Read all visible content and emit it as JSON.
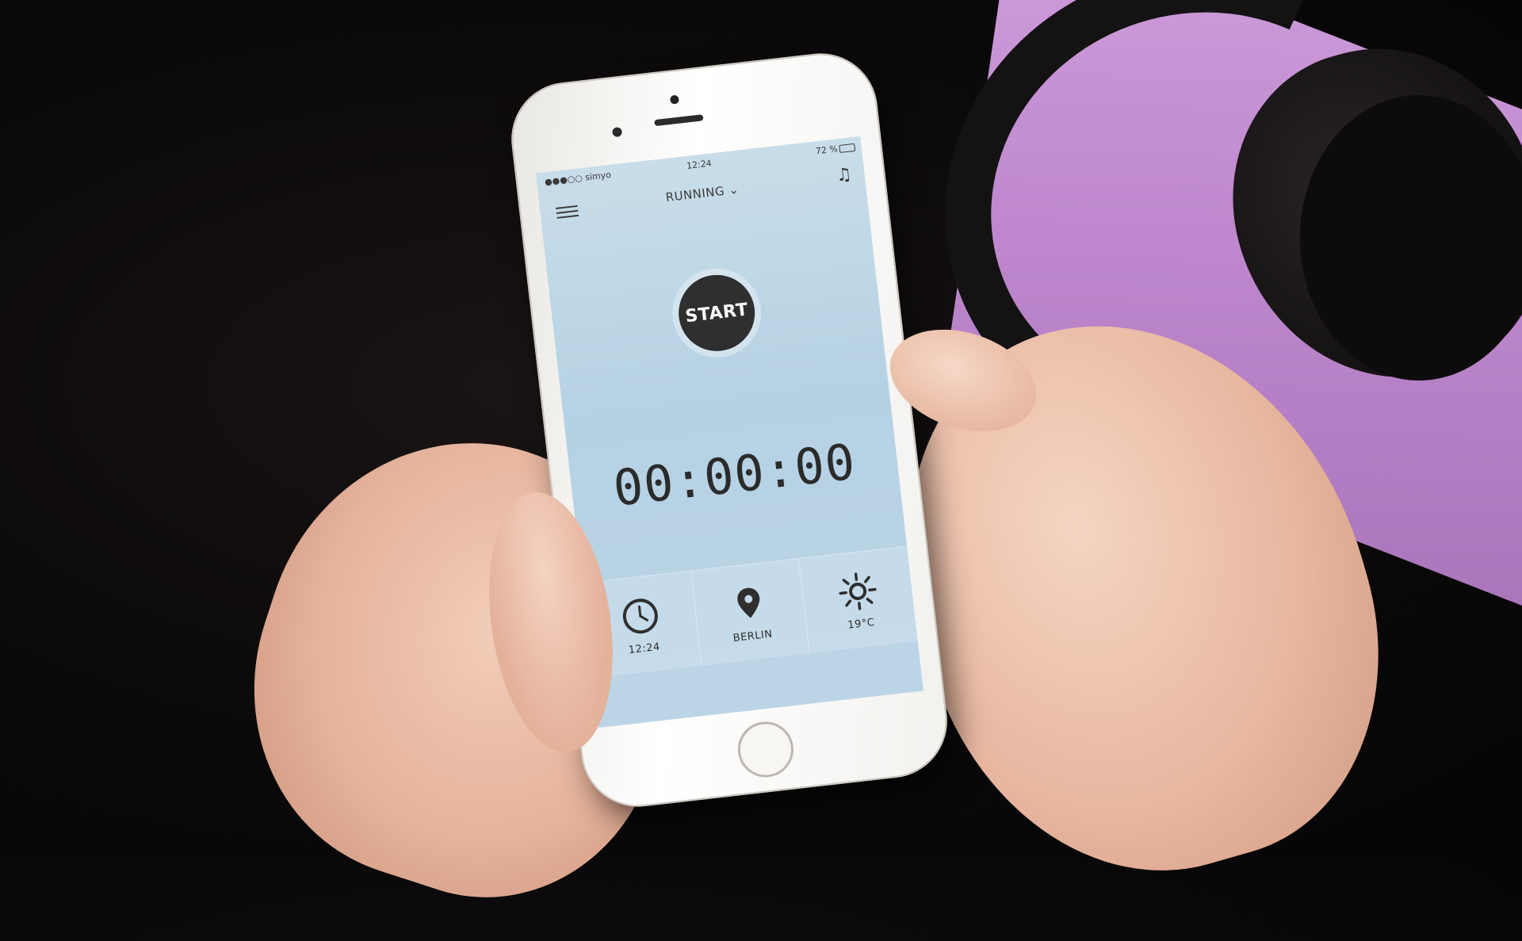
{
  "status_bar": {
    "carrier": "●●●○○ simyo",
    "time": "12:24",
    "battery": "72 %",
    "battery_level": 0.72
  },
  "header": {
    "activity": "RUNNING ⌄",
    "menu_icon": "hamburger-menu-icon",
    "music_icon": "music-note-icon",
    "music_glyph": "♫"
  },
  "workout": {
    "start_label": "START",
    "timer": "00:00:00"
  },
  "info": {
    "time_label": "12:24",
    "location_label": "BERLIN",
    "weather_label": "19°C",
    "time_icon": "clock-icon",
    "location_icon": "map-pin-icon",
    "weather_icon": "sun-icon"
  },
  "colors": {
    "screen": "#c1d8e8",
    "start_button": "#2f2f30",
    "text": "#2b2b2b",
    "background_accent": "#c98fd9"
  }
}
